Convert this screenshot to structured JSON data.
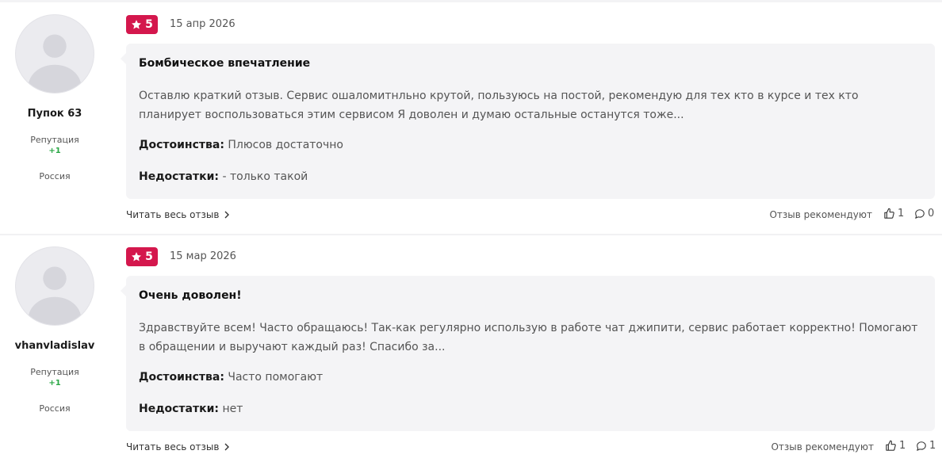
{
  "reviews": [
    {
      "user": {
        "name": "Пупок 63",
        "reputation_label": "Репутация",
        "reputation_value": "+1",
        "country": "Россия"
      },
      "rating": "5",
      "date": "15 апр 2026",
      "title": "Бомбическое впечатление",
      "text": "Оставлю краткий отзыв. Сервис ошаломитнльно крутой, пользуюсь на постой, рекомендую для тех кто в курсе и тех кто планирует воспользоваться этим сервисом Я доволен и думаю остальные останутся тоже...",
      "pros_label": "Достоинства:",
      "pros": "Плюсов достаточно",
      "cons_label": "Недостатки:",
      "cons": "- только такой",
      "read_more": "Читать весь отзыв",
      "recommend_label": "Отзыв рекомендуют",
      "likes": "1",
      "comments": "0"
    },
    {
      "user": {
        "name": "vhanvladislav",
        "reputation_label": "Репутация",
        "reputation_value": "+1",
        "country": "Россия"
      },
      "rating": "5",
      "date": "15 мар 2026",
      "title": "Очень доволен!",
      "text": "Здравствуйте всем! Часто обращаюсь! Так-как регулярно использую в работе чат джипити, сервис работает корректно! Помогают в обращении и выручают каждый раз! Спасибо за...",
      "pros_label": "Достоинства:",
      "pros": "Часто помогают",
      "cons_label": "Недостатки:",
      "cons": "нет",
      "read_more": "Читать весь отзыв",
      "recommend_label": "Отзыв рекомендуют",
      "likes": "1",
      "comments": "1"
    }
  ],
  "icons": {
    "star": "star-icon",
    "chevron": "chevron-right-icon",
    "like": "thumbs-up-icon",
    "comment": "comment-bubble-icon",
    "avatar": "default-avatar-icon"
  },
  "colors": {
    "badge": "#d4174d",
    "reputation": "#2aa745",
    "card_bg": "#f4f4f6"
  }
}
